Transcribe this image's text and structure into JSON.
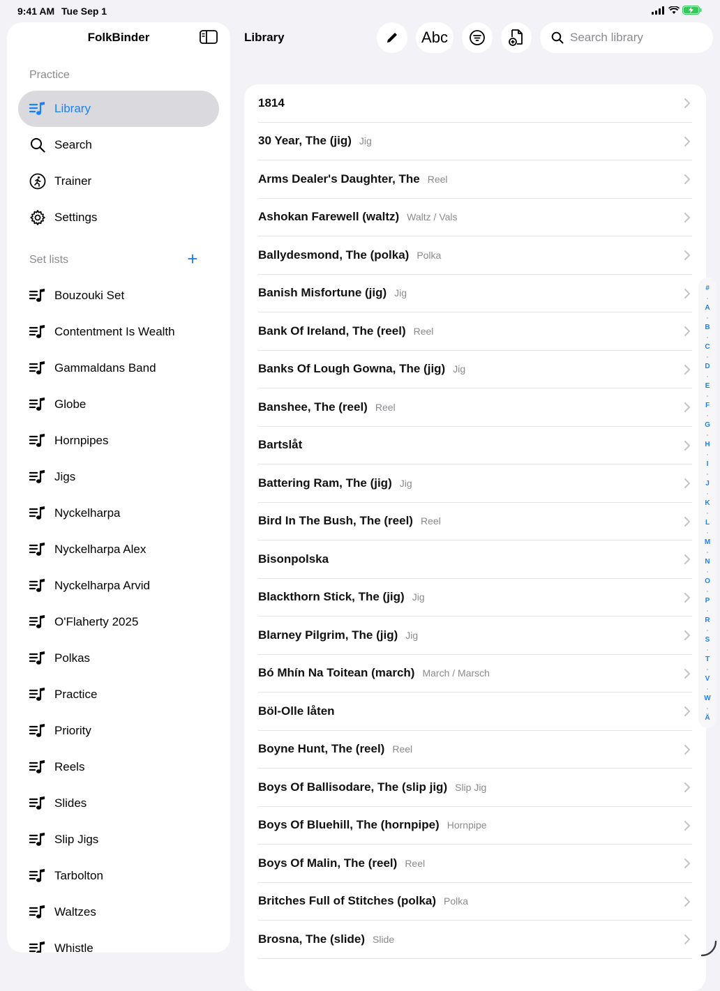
{
  "status": {
    "time": "9:41 AM",
    "date": "Tue Sep 1"
  },
  "sidebar": {
    "title": "FolkBinder",
    "practice_header": "Practice",
    "nav": [
      {
        "label": "Library",
        "icon": "music-list-icon",
        "active": true
      },
      {
        "label": "Search",
        "icon": "search-icon"
      },
      {
        "label": "Trainer",
        "icon": "runner-icon"
      },
      {
        "label": "Settings",
        "icon": "gear-icon"
      }
    ],
    "setlists_header": "Set lists",
    "add_label": "+",
    "setlists": [
      "Bouzouki Set",
      "Contentment Is Wealth",
      "Gammaldans Band",
      "Globe",
      "Hornpipes",
      "Jigs",
      "Nyckelharpa",
      "Nyckelharpa Alex",
      "Nyckelharpa Arvid",
      "O'Flaherty 2025",
      "Polkas",
      "Practice",
      "Priority",
      "Reels",
      "Slides",
      "Slip Jigs",
      "Tarbolton",
      "Waltzes",
      "Whistle"
    ]
  },
  "main": {
    "title": "Library",
    "abc_label": "Abc",
    "search_placeholder": "Search library"
  },
  "tunes": [
    {
      "title": "1814",
      "type": ""
    },
    {
      "title": "30 Year, The (jig)",
      "type": "Jig"
    },
    {
      "title": "Arms Dealer's Daughter, The",
      "type": "Reel"
    },
    {
      "title": "Ashokan Farewell (waltz)",
      "type": "Waltz / Vals"
    },
    {
      "title": "Ballydesmond, The (polka)",
      "type": "Polka"
    },
    {
      "title": "Banish Misfortune (jig)",
      "type": "Jig"
    },
    {
      "title": "Bank Of Ireland, The (reel)",
      "type": "Reel"
    },
    {
      "title": "Banks Of Lough Gowna, The (jig)",
      "type": "Jig"
    },
    {
      "title": "Banshee, The (reel)",
      "type": "Reel"
    },
    {
      "title": "Bartslåt",
      "type": ""
    },
    {
      "title": "Battering Ram, The (jig)",
      "type": "Jig"
    },
    {
      "title": "Bird In The Bush, The (reel)",
      "type": "Reel"
    },
    {
      "title": "Bisonpolska",
      "type": ""
    },
    {
      "title": "Blackthorn Stick, The (jig)",
      "type": "Jig"
    },
    {
      "title": "Blarney Pilgrim, The (jig)",
      "type": "Jig"
    },
    {
      "title": "Bó Mhín Na Toitean (march)",
      "type": "March / Marsch"
    },
    {
      "title": "Böl-Olle låten",
      "type": ""
    },
    {
      "title": "Boyne Hunt, The (reel)",
      "type": "Reel"
    },
    {
      "title": "Boys Of Ballisodare, The (slip jig)",
      "type": "Slip Jig"
    },
    {
      "title": "Boys Of Bluehill, The (hornpipe)",
      "type": "Hornpipe"
    },
    {
      "title": "Boys Of Malin, The (reel)",
      "type": "Reel"
    },
    {
      "title": "Britches Full of Stitches (polka)",
      "type": "Polka"
    },
    {
      "title": "Brosna, The (slide)",
      "type": "Slide"
    }
  ],
  "index_letters": [
    "#",
    "A",
    "B",
    "C",
    "D",
    "E",
    "F",
    "G",
    "H",
    "I",
    "J",
    "K",
    "L",
    "M",
    "N",
    "O",
    "P",
    "R",
    "S",
    "T",
    "V",
    "W",
    "Ä"
  ],
  "colors": {
    "accent": "#1a82f7",
    "background": "#f2f2f7",
    "secondary_text": "#8a8a8e"
  }
}
